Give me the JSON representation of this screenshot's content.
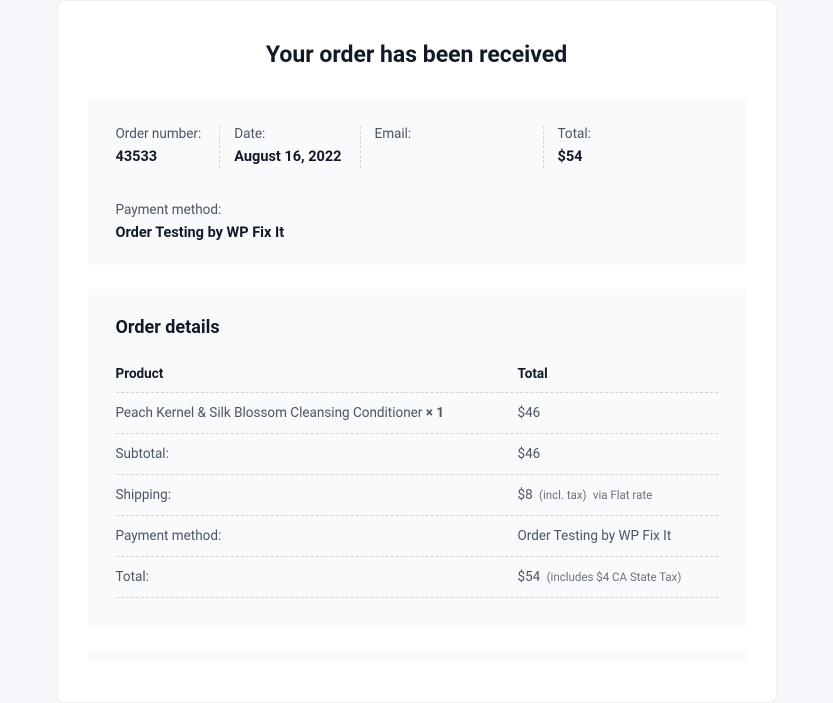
{
  "title": "Your order has been received",
  "summary": {
    "order_number": {
      "label": "Order number:",
      "value": "43533"
    },
    "date": {
      "label": "Date:",
      "value": "August 16, 2022"
    },
    "email": {
      "label": "Email:",
      "value": ""
    },
    "total": {
      "label": "Total:",
      "value": "$54"
    },
    "payment_method": {
      "label": "Payment method:",
      "value": "Order Testing by WP Fix It"
    }
  },
  "details": {
    "title": "Order details",
    "header": {
      "product": "Product",
      "total": "Total"
    },
    "line_item": {
      "name": "Peach Kernel & Silk Blossom Cleansing Conditioner ",
      "qty": "× 1",
      "price": "$46"
    },
    "rows": {
      "subtotal": {
        "label": "Subtotal:",
        "value": "$46"
      },
      "shipping": {
        "label": "Shipping:",
        "value": "$8",
        "note1": "(incl. tax)",
        "note2": "via Flat rate"
      },
      "payment_method": {
        "label": "Payment method:",
        "value": "Order Testing by WP Fix It"
      },
      "total": {
        "label": "Total:",
        "value": "$54",
        "note": "(includes $4 CA State Tax)"
      }
    }
  }
}
